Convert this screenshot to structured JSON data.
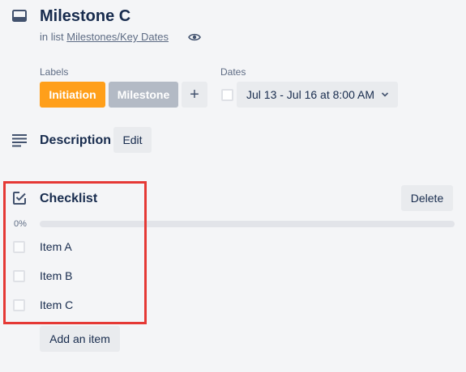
{
  "card": {
    "title": "Milestone C",
    "in_list_prefix": "in list",
    "list_name": "Milestones/Key Dates"
  },
  "labels": {
    "heading": "Labels",
    "items": [
      {
        "name": "Initiation",
        "color": "#ff9f1a"
      },
      {
        "name": "Milestone",
        "color": "#b3bac5"
      }
    ],
    "add_symbol": "+"
  },
  "dates": {
    "heading": "Dates",
    "value": "Jul 13 - Jul 16 at 8:00 AM",
    "checked": false
  },
  "description": {
    "title": "Description",
    "edit_label": "Edit"
  },
  "checklist": {
    "title": "Checklist",
    "delete_label": "Delete",
    "progress_text": "0%",
    "progress": 0,
    "items": [
      {
        "text": "Item A",
        "checked": false
      },
      {
        "text": "Item B",
        "checked": false
      },
      {
        "text": "Item C",
        "checked": false
      }
    ],
    "add_item_label": "Add an item"
  },
  "colors": {
    "highlight": "#e53935",
    "accent": "#5ba4cf"
  }
}
